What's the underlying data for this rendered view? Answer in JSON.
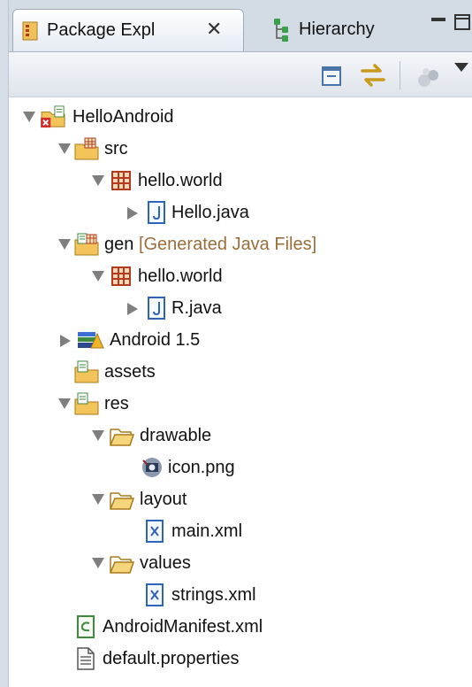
{
  "tabs": {
    "active": {
      "label": "Package Expl",
      "close": "✕"
    },
    "inactive": {
      "label": "Hierarchy"
    }
  },
  "toolbar": {
    "collapse_all": "collapse-all",
    "link_with_editor": "link-with-editor",
    "view_menu": "view-menu"
  },
  "tree": {
    "project": "HelloAndroid",
    "src": "src",
    "src_package": "hello.world",
    "src_file": "Hello.java",
    "gen": "gen",
    "gen_decoration": "[Generated Java Files]",
    "gen_package": "hello.world",
    "gen_file": "R.java",
    "library": "Android 1.5",
    "assets": "assets",
    "res": "res",
    "drawable": "drawable",
    "drawable_file": "icon.png",
    "layout": "layout",
    "layout_file": "main.xml",
    "values": "values",
    "values_file": "strings.xml",
    "manifest": "AndroidManifest.xml",
    "properties": "default.properties"
  },
  "colors": {
    "panel_bg": "#ffffff",
    "tab_bar": "#d3dbe5",
    "decoration_text": "#9a6e3a",
    "folder": "#f3c45a",
    "package": "#b33a1e",
    "java_file": "#2f63b8"
  }
}
